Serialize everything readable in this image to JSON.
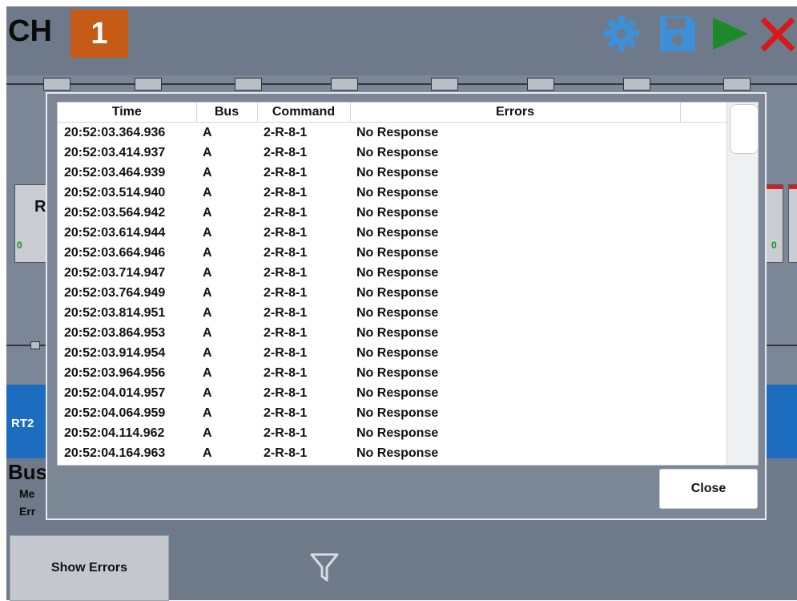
{
  "header": {
    "channel_label": "CH",
    "channel_number": "1",
    "icons": [
      "gear-icon",
      "save-icon",
      "play-icon",
      "close-icon"
    ],
    "colors": {
      "channel_badge": "#c65a17",
      "gear": "#3d8fd6",
      "save": "#3d8fd6",
      "play": "#1d8a2a",
      "close": "#d61a1a"
    }
  },
  "background": {
    "rt_box_letter": "R",
    "left_count": "0",
    "right_count": "0",
    "rt_strip_label": "RT2",
    "bus_title": "Bus",
    "bus_sub_1": "Me",
    "bus_sub_2": "Err",
    "show_errors_label": "Show Errors",
    "filter_icon": "filter-icon"
  },
  "modal": {
    "columns": [
      "Time",
      "Bus",
      "Command",
      "Errors"
    ],
    "rows": [
      {
        "time": "20:52:03.364.936",
        "bus": "A",
        "command": "2-R-8-1",
        "error": "No Response"
      },
      {
        "time": "20:52:03.414.937",
        "bus": "A",
        "command": "2-R-8-1",
        "error": "No Response"
      },
      {
        "time": "20:52:03.464.939",
        "bus": "A",
        "command": "2-R-8-1",
        "error": "No Response"
      },
      {
        "time": "20:52:03.514.940",
        "bus": "A",
        "command": "2-R-8-1",
        "error": "No Response"
      },
      {
        "time": "20:52:03.564.942",
        "bus": "A",
        "command": "2-R-8-1",
        "error": "No Response"
      },
      {
        "time": "20:52:03.614.944",
        "bus": "A",
        "command": "2-R-8-1",
        "error": "No Response"
      },
      {
        "time": "20:52:03.664.946",
        "bus": "A",
        "command": "2-R-8-1",
        "error": "No Response"
      },
      {
        "time": "20:52:03.714.947",
        "bus": "A",
        "command": "2-R-8-1",
        "error": "No Response"
      },
      {
        "time": "20:52:03.764.949",
        "bus": "A",
        "command": "2-R-8-1",
        "error": "No Response"
      },
      {
        "time": "20:52:03.814.951",
        "bus": "A",
        "command": "2-R-8-1",
        "error": "No Response"
      },
      {
        "time": "20:52:03.864.953",
        "bus": "A",
        "command": "2-R-8-1",
        "error": "No Response"
      },
      {
        "time": "20:52:03.914.954",
        "bus": "A",
        "command": "2-R-8-1",
        "error": "No Response"
      },
      {
        "time": "20:52:03.964.956",
        "bus": "A",
        "command": "2-R-8-1",
        "error": "No Response"
      },
      {
        "time": "20:52:04.014.957",
        "bus": "A",
        "command": "2-R-8-1",
        "error": "No Response"
      },
      {
        "time": "20:52:04.064.959",
        "bus": "A",
        "command": "2-R-8-1",
        "error": "No Response"
      },
      {
        "time": "20:52:04.114.962",
        "bus": "A",
        "command": "2-R-8-1",
        "error": "No Response"
      },
      {
        "time": "20:52:04.164.963",
        "bus": "A",
        "command": "2-R-8-1",
        "error": "No Response"
      }
    ],
    "close_label": "Close"
  }
}
